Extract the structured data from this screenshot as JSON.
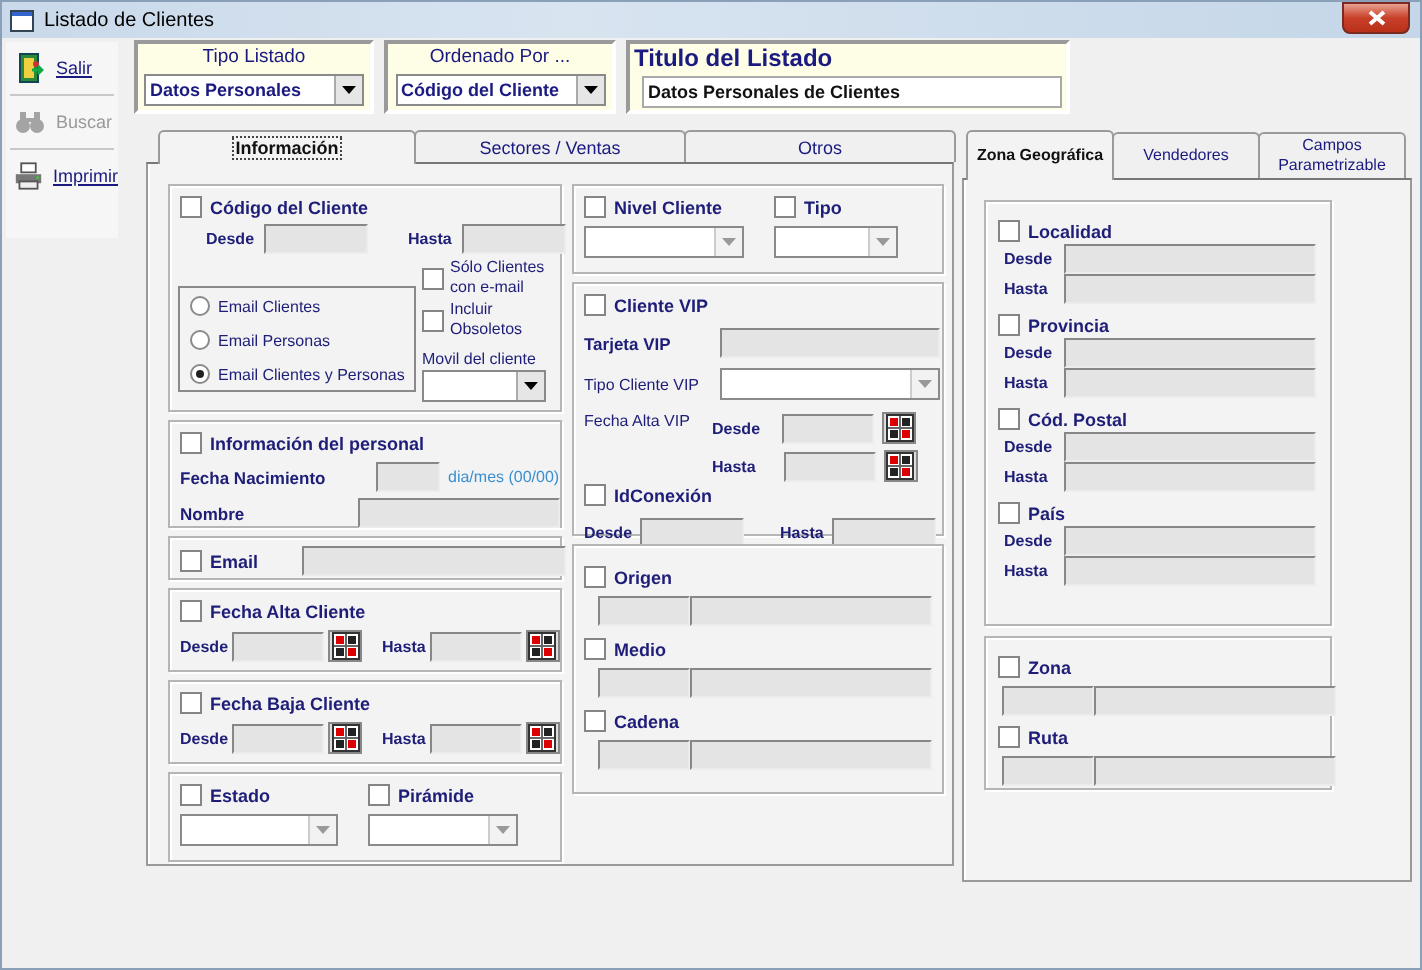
{
  "window": {
    "title": "Listado de Clientes"
  },
  "toolbar": [
    {
      "kind": "exit",
      "label": "Salir",
      "disabled": false
    },
    {
      "kind": "search",
      "label": "Buscar",
      "disabled": true
    },
    {
      "kind": "print",
      "label": "Imprimir",
      "disabled": false
    }
  ],
  "header": {
    "tipo_listado": {
      "label": "Tipo Listado",
      "value": "Datos Personales"
    },
    "ordenado_por": {
      "label": "Ordenado Por ...",
      "value": "Código del Cliente"
    },
    "titulo": {
      "label": "Titulo del Listado",
      "value": "Datos Personales de Clientes"
    }
  },
  "main_tabs": [
    {
      "label": "Información",
      "selected": true
    },
    {
      "label": "Sectores /  Ventas",
      "selected": false
    },
    {
      "label": "Otros",
      "selected": false
    }
  ],
  "informacion": {
    "codigo_cliente": {
      "label": "Código del Cliente",
      "checked": false,
      "from_label": "Desde",
      "to_label": "Hasta"
    },
    "email_options": [
      {
        "label": "Email Clientes",
        "selected": false
      },
      {
        "label": "Email Personas",
        "selected": false
      },
      {
        "label": "Email Clientes y Personas",
        "selected": true
      }
    ],
    "solo_email": {
      "label": "Sólo Clientes con e-mail",
      "checked": false
    },
    "incluir_obsoletos": {
      "label": "Incluir Obsoletos",
      "checked": false
    },
    "movil": {
      "label": "Movil del cliente"
    },
    "personal": {
      "label": "Información del personal",
      "checked": false,
      "birth_label": "Fecha Nacimiento",
      "birth_hint": "dia/mes (00/00)",
      "name_label": "Nombre"
    },
    "email": {
      "label": "Email",
      "checked": false
    },
    "fechas": [
      {
        "label": "Fecha Alta Cliente",
        "checked": false,
        "from_label": "Desde",
        "to_label": "Hasta"
      },
      {
        "label": "Fecha Baja Cliente",
        "checked": false,
        "from_label": "Desde",
        "to_label": "Hasta"
      }
    ],
    "estado": {
      "label": "Estado",
      "checked": false
    },
    "piramide": {
      "label": "Pirámide",
      "checked": false
    },
    "nivel_cliente": {
      "label": "Nivel Cliente",
      "checked": false
    },
    "tipo": {
      "label": "Tipo",
      "checked": false
    },
    "cliente_vip": {
      "label": "Cliente VIP",
      "checked": false,
      "card_label": "Tarjeta VIP",
      "type_label": "Tipo Cliente VIP",
      "date_label": "Fecha Alta VIP",
      "from_label": "Desde",
      "to_label": "Hasta"
    },
    "id_conexion": {
      "label": "IdConexión",
      "checked": false,
      "from_label": "Desde",
      "to_label": "Hasta"
    },
    "codes": [
      {
        "label": "Origen",
        "checked": false
      },
      {
        "label": "Medio",
        "checked": false
      },
      {
        "label": "Cadena",
        "checked": false
      }
    ]
  },
  "side_tabs": [
    {
      "label": "Zona Geográfica",
      "selected": true
    },
    {
      "label": "Vendedores",
      "selected": false
    },
    {
      "label": "Campos Parametrizable",
      "selected": false
    }
  ],
  "zona_geografica": {
    "ranges": [
      {
        "label": "Localidad",
        "checked": false,
        "from_label": "Desde",
        "to_label": "Hasta"
      },
      {
        "label": "Provincia",
        "checked": false,
        "from_label": "Desde",
        "to_label": "Hasta"
      },
      {
        "label": "Cód. Postal",
        "checked": false,
        "from_label": "Desde",
        "to_label": "Hasta"
      },
      {
        "label": "País",
        "checked": false,
        "from_label": "Desde",
        "to_label": "Hasta"
      }
    ],
    "codes": [
      {
        "label": "Zona",
        "checked": false
      },
      {
        "label": "Ruta",
        "checked": false
      }
    ]
  }
}
